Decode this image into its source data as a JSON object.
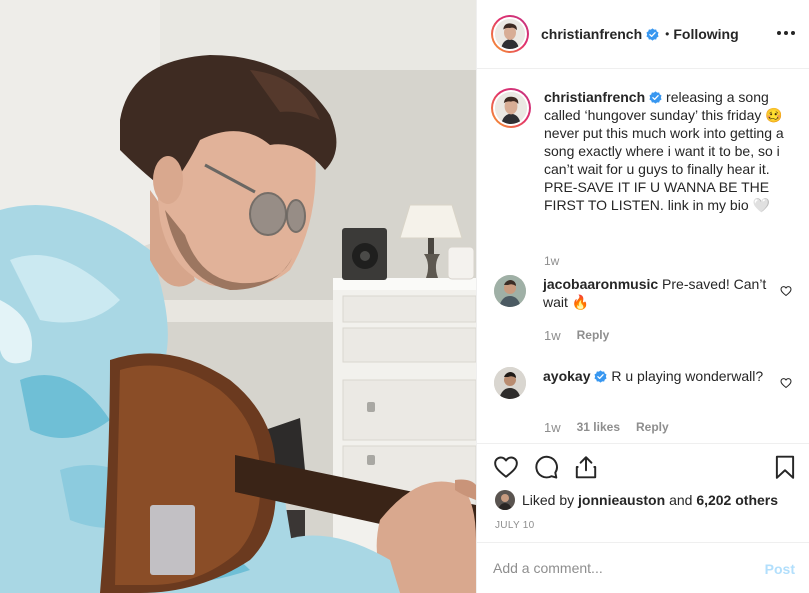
{
  "post": {
    "photo_alt": "",
    "author": "christianfrench",
    "follow_separator": "•",
    "follow_state": "Following",
    "more_icon": "more-horizontal-icon"
  },
  "caption": {
    "username": "christianfrench",
    "text": "releasing a song called ‘hungover sunday’ this friday 🥴 never put this much work into getting a song exactly where i want it to be, so i can’t wait for u guys to finally hear it. PRE-SAVE IT IF U WANNA BE THE FIRST TO LISTEN. link in my bio 🤍",
    "time": "1w"
  },
  "comments": [
    {
      "username": "jacobaaronmusic",
      "verified": false,
      "text": "Pre-saved! Can’t wait 🔥",
      "time": "1w",
      "likes": "",
      "reply": "Reply"
    },
    {
      "username": "ayokay",
      "verified": true,
      "text": "R u playing wonderwall?",
      "time": "1w",
      "likes": "31 likes",
      "reply": "Reply"
    }
  ],
  "actions": {
    "icons": [
      "heart-icon",
      "comment-icon",
      "share-icon",
      "bookmark-icon"
    ],
    "liked_by_prefix": "Liked by",
    "liked_by_user": "jonnieauston",
    "liked_by_and": "and",
    "others_count": "6,202 others",
    "date": "JULY 10"
  },
  "add_comment": {
    "placeholder": "Add a comment...",
    "post_label": "Post"
  },
  "colors": {
    "verified_blue": "#3897f0",
    "post_disabled": "#b2dffc",
    "muted": "#8e8e8e",
    "border": "#efefef"
  }
}
